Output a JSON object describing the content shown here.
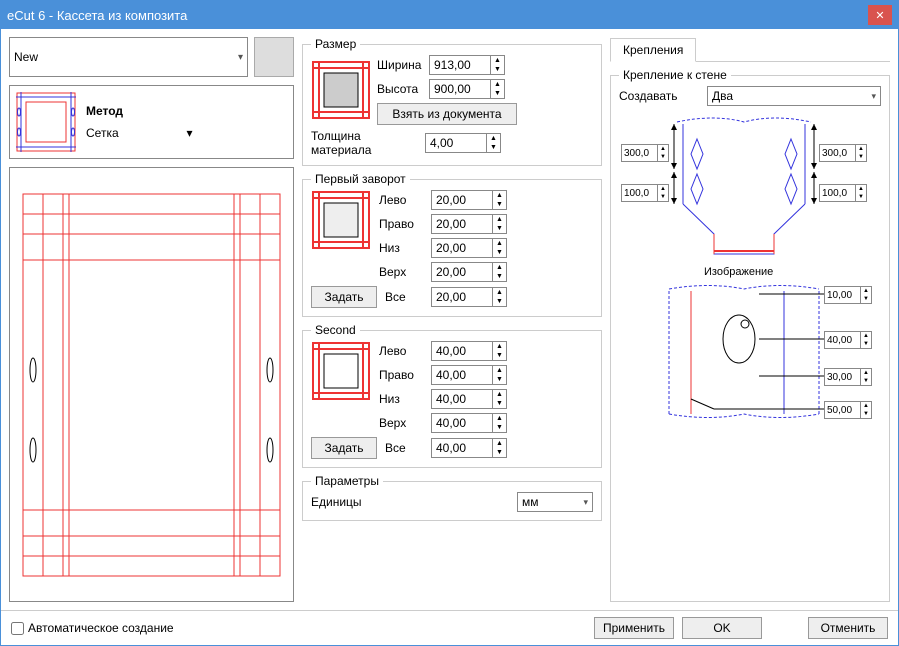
{
  "window": {
    "title": "eCut 6 - Кассета из композита"
  },
  "left": {
    "preset": "New",
    "method_label": "Метод",
    "method_value": "Сетка"
  },
  "size": {
    "legend": "Размер",
    "width_label": "Ширина",
    "width": "913,00",
    "height_label": "Высота",
    "height": "900,00",
    "from_doc_btn": "Взять из документа",
    "thickness_label": "Толщина материала",
    "thickness": "4,00"
  },
  "fold1": {
    "legend": "Первый заворот",
    "left_label": "Лево",
    "left": "20,00",
    "right_label": "Право",
    "right": "20,00",
    "bottom_label": "Низ",
    "bottom": "20,00",
    "top_label": "Верх",
    "top": "20,00",
    "set_btn": "Задать",
    "all_label": "Все",
    "all": "20,00"
  },
  "fold2": {
    "legend": "Second",
    "left_label": "Лево",
    "left": "40,00",
    "right_label": "Право",
    "right": "40,00",
    "bottom_label": "Низ",
    "bottom": "40,00",
    "top_label": "Верх",
    "top": "40,00",
    "set_btn": "Задать",
    "all_label": "Все",
    "all": "40,00"
  },
  "params": {
    "legend": "Параметры",
    "units_label": "Единицы",
    "units_value": "мм"
  },
  "tabs": {
    "fasteners": "Крепления"
  },
  "wall": {
    "legend": "Крепление к стене",
    "create_label": "Создавать",
    "create_value": "Два",
    "d1": "300,0",
    "d2": "300,0",
    "d3": "100,0",
    "d4": "100,0",
    "image_label": "Изображение",
    "p1": "10,00",
    "p2": "40,00",
    "p3": "30,00",
    "p4": "50,00"
  },
  "footer": {
    "auto_label": "Автоматическое создание",
    "apply": "Применить",
    "ok": "OK",
    "cancel": "Отменить"
  }
}
